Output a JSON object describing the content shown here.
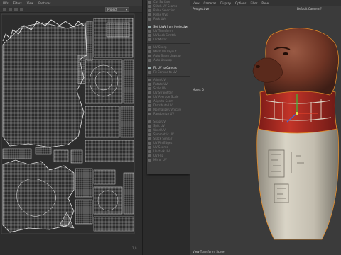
{
  "uv_editor": {
    "menu": [
      "UVs",
      "Filters",
      "View",
      "Features"
    ],
    "projection_select": "Project"
  },
  "tool_menu": {
    "items": [
      {
        "label": "Cut Surface",
        "active": false
      },
      {
        "label": "Stitch UV Seams",
        "active": false
      },
      {
        "label": "Relax Selection",
        "active": false
      },
      {
        "label": "Relax UVs",
        "active": false
      },
      {
        "label": "Pack UVs",
        "active": false
      },
      {
        "sep": true
      },
      {
        "label": "Set UVW from Projection",
        "active": true,
        "check": true
      },
      {
        "label": "UV Transform",
        "active": false
      },
      {
        "label": "UV Lock Stretch",
        "active": false
      },
      {
        "label": "UV Mirror",
        "active": false
      },
      {
        "sep": true
      },
      {
        "label": "UV Sharp",
        "active": false
      },
      {
        "label": "Mesh UV Layout",
        "active": false
      },
      {
        "label": "Auto Seam Unwrap",
        "active": false
      },
      {
        "label": "Auto Unwrap",
        "active": false
      },
      {
        "sep": true
      },
      {
        "label": "Fit UV to Canvas",
        "active": true
      },
      {
        "label": "Fit Canvas to UV",
        "active": false
      },
      {
        "sep": true
      },
      {
        "label": "Align UV",
        "active": false
      },
      {
        "label": "Rotate UV",
        "active": false
      },
      {
        "label": "Scale UV",
        "active": false
      },
      {
        "label": "UV Straighten",
        "active": false
      },
      {
        "label": "UV Average Scale",
        "active": false
      },
      {
        "label": "Align to Seam",
        "active": false
      },
      {
        "label": "Distribute UV",
        "active": false
      },
      {
        "label": "Normalize UV Scale",
        "active": false
      },
      {
        "label": "Randomize UV",
        "active": false
      },
      {
        "sep": true
      },
      {
        "label": "Snap UV",
        "active": false
      },
      {
        "label": "Split UV",
        "active": false
      },
      {
        "label": "Weld UV",
        "active": false
      },
      {
        "label": "Symmetric UV",
        "active": false
      },
      {
        "label": "Stack Similar",
        "active": false
      },
      {
        "label": "UV Pin Edges",
        "active": false
      },
      {
        "label": "UV Seams",
        "active": false
      },
      {
        "label": "Unstack UV",
        "active": false
      },
      {
        "label": "UV Flip",
        "active": false
      },
      {
        "label": "Mirror UV",
        "active": false
      }
    ]
  },
  "viewport": {
    "menu": [
      "View",
      "Cameras",
      "Display",
      "Options",
      "Filter",
      "Panel"
    ],
    "camera_label": "Perspective",
    "render_camera": "Default Camera ?",
    "move_label": "Move: 0",
    "footer": "View Transform: Scene"
  },
  "colors": {
    "uv_background": "#2d2d2d",
    "uv_island": "#c8c8c8",
    "panel_menu": "#3c3c3c",
    "viewport_bg": "#3b3b3b",
    "jar_stone": "#c7c2b4",
    "head_brown": "#7a3e2c",
    "red_band": "#b22a22",
    "selection_outline": "#e08a2a"
  }
}
